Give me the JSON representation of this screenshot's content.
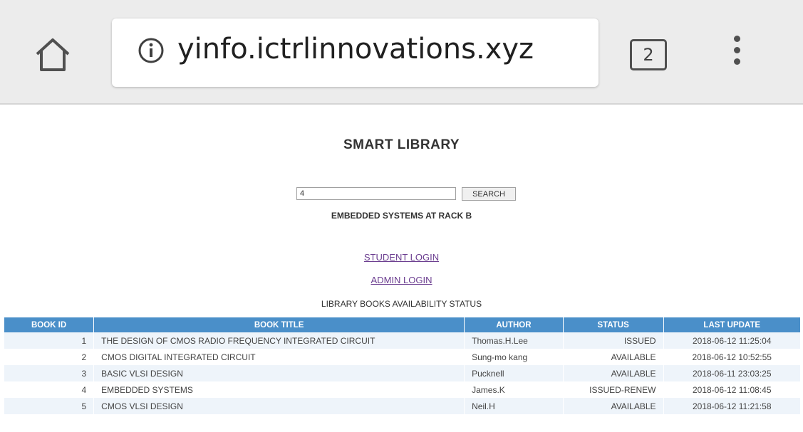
{
  "browser": {
    "url": "yinfo.ictrlinnovations.xyz",
    "tab_count": "2",
    "icons": [
      "home-icon",
      "info-icon",
      "tabs-icon",
      "menu-icon"
    ]
  },
  "page": {
    "title": "SMART LIBRARY",
    "search_value": "4",
    "search_button": "SEARCH",
    "result": "EMBEDDED SYSTEMS AT RACK B",
    "student_login": "STUDENT LOGIN",
    "admin_login": "ADMIN LOGIN",
    "table_caption": "LIBRARY BOOKS AVAILABILITY STATUS"
  },
  "table": {
    "headers": [
      "BOOK ID",
      "BOOK TITLE",
      "AUTHOR",
      "STATUS",
      "LAST UPDATE"
    ],
    "rows": [
      [
        "1",
        "THE DESIGN OF CMOS RADIO FREQUENCY INTEGRATED CIRCUIT",
        "Thomas.H.Lee",
        "ISSUED",
        "2018-06-12 11:25:04"
      ],
      [
        "2",
        "CMOS DIGITAL INTEGRATED CIRCUIT",
        "Sung-mo kang",
        "AVAILABLE",
        "2018-06-12 10:52:55"
      ],
      [
        "3",
        "BASIC VLSI DESIGN",
        "Pucknell",
        "AVAILABLE",
        "2018-06-11 23:03:25"
      ],
      [
        "4",
        "EMBEDDED SYSTEMS",
        "James.K",
        "ISSUED-RENEW",
        "2018-06-12 11:08:45"
      ],
      [
        "5",
        "CMOS VLSI DESIGN",
        "Neil.H",
        "AVAILABLE",
        "2018-06-12 11:21:58"
      ]
    ]
  },
  "colors": {
    "header_bg": "#4a8fc9",
    "row_alt": "#eef4fa",
    "link": "#6a3c8f",
    "browser_bar": "#ececec"
  }
}
